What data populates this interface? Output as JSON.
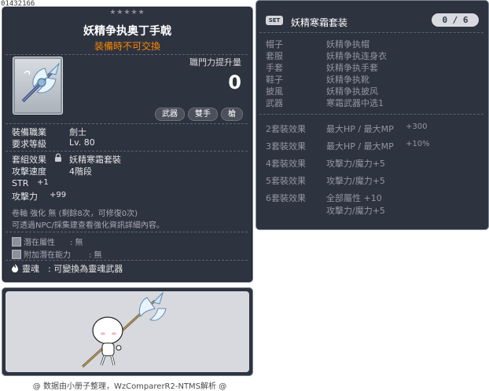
{
  "item_id": "01432166",
  "tooltip": {
    "stars": "★★★★★",
    "title": "妖精争执奥丁手戟",
    "subtitle": "装備時不可交換",
    "attack_increase_label": "職門力提升量",
    "attack_increase_value": "0",
    "tags": [
      "武器",
      "雙手",
      "槍"
    ],
    "stats": [
      {
        "label": "裝備職業",
        "value": "劍士"
      },
      {
        "label": "要求等級",
        "value": "Lv. 80"
      }
    ],
    "set_effect": {
      "label": "套組效果",
      "value": "妖精寒霜套裝"
    },
    "attack_speed": {
      "label": "攻擊速度",
      "value": "4階段"
    },
    "str": {
      "label": "STR",
      "value": "+1"
    },
    "attack": {
      "label": "攻擊力",
      "value": "+99"
    },
    "scroll_line": "卷軸 強化 無 (剩餘8次，可修復0次)",
    "npc_line": "可透過NPC/採集建查看強化資訊詳細內容。",
    "potential": {
      "label": "潛在屬性",
      "value": ": 無"
    },
    "additional_potential": {
      "label": "附加潛在能力",
      "value": ": 無"
    },
    "soul": {
      "label": "靈魂",
      "value": ": 可變換為靈魂武器"
    }
  },
  "footer": "@ 数据由小册子整理，WzComparerR2-NTMS解析 @",
  "set_panel": {
    "badge": "SET",
    "name": "妖精寒霜套装",
    "count": "0 / 6",
    "items": [
      {
        "slot": "帽子",
        "name": "妖精争执帽"
      },
      {
        "slot": "套服",
        "name": "妖精争执连身衣"
      },
      {
        "slot": "手套",
        "name": "妖精争执手套"
      },
      {
        "slot": "鞋子",
        "name": "妖精争执靴"
      },
      {
        "slot": "披風",
        "name": "妖精争执披风"
      },
      {
        "slot": "武器",
        "name": "寒霜武器中选1"
      }
    ],
    "effects": [
      {
        "key": "2套裝效果",
        "lines": [
          {
            "stat": "最大HP / 最大MP",
            "num": "+300"
          }
        ]
      },
      {
        "key": "3套裝效果",
        "lines": [
          {
            "stat": "最大HP / 最大MP",
            "num": "+10%"
          }
        ]
      },
      {
        "key": "4套裝效果",
        "lines": [
          {
            "stat": "攻擊力/魔力+5",
            "num": ""
          }
        ]
      },
      {
        "key": "5套裝效果",
        "lines": [
          {
            "stat": "攻擊力/魔力+5",
            "num": ""
          }
        ]
      },
      {
        "key": "6套裝效果",
        "lines": [
          {
            "stat": "全部屬性 +10",
            "num": ""
          },
          {
            "stat": "攻擊力/魔力+5",
            "num": ""
          }
        ]
      }
    ]
  },
  "colors": {
    "panel_bg": "#2e3340",
    "panel_border": "#7c8594",
    "title": "#ffffff",
    "subtitle_orange": "#ff8800",
    "set_text_gray": "#9296a0"
  },
  "icons": [
    "lock-icon",
    "gem-icon",
    "gem-icon",
    "flame-icon",
    "weapon-item-icon",
    "set-badge-icon"
  ]
}
